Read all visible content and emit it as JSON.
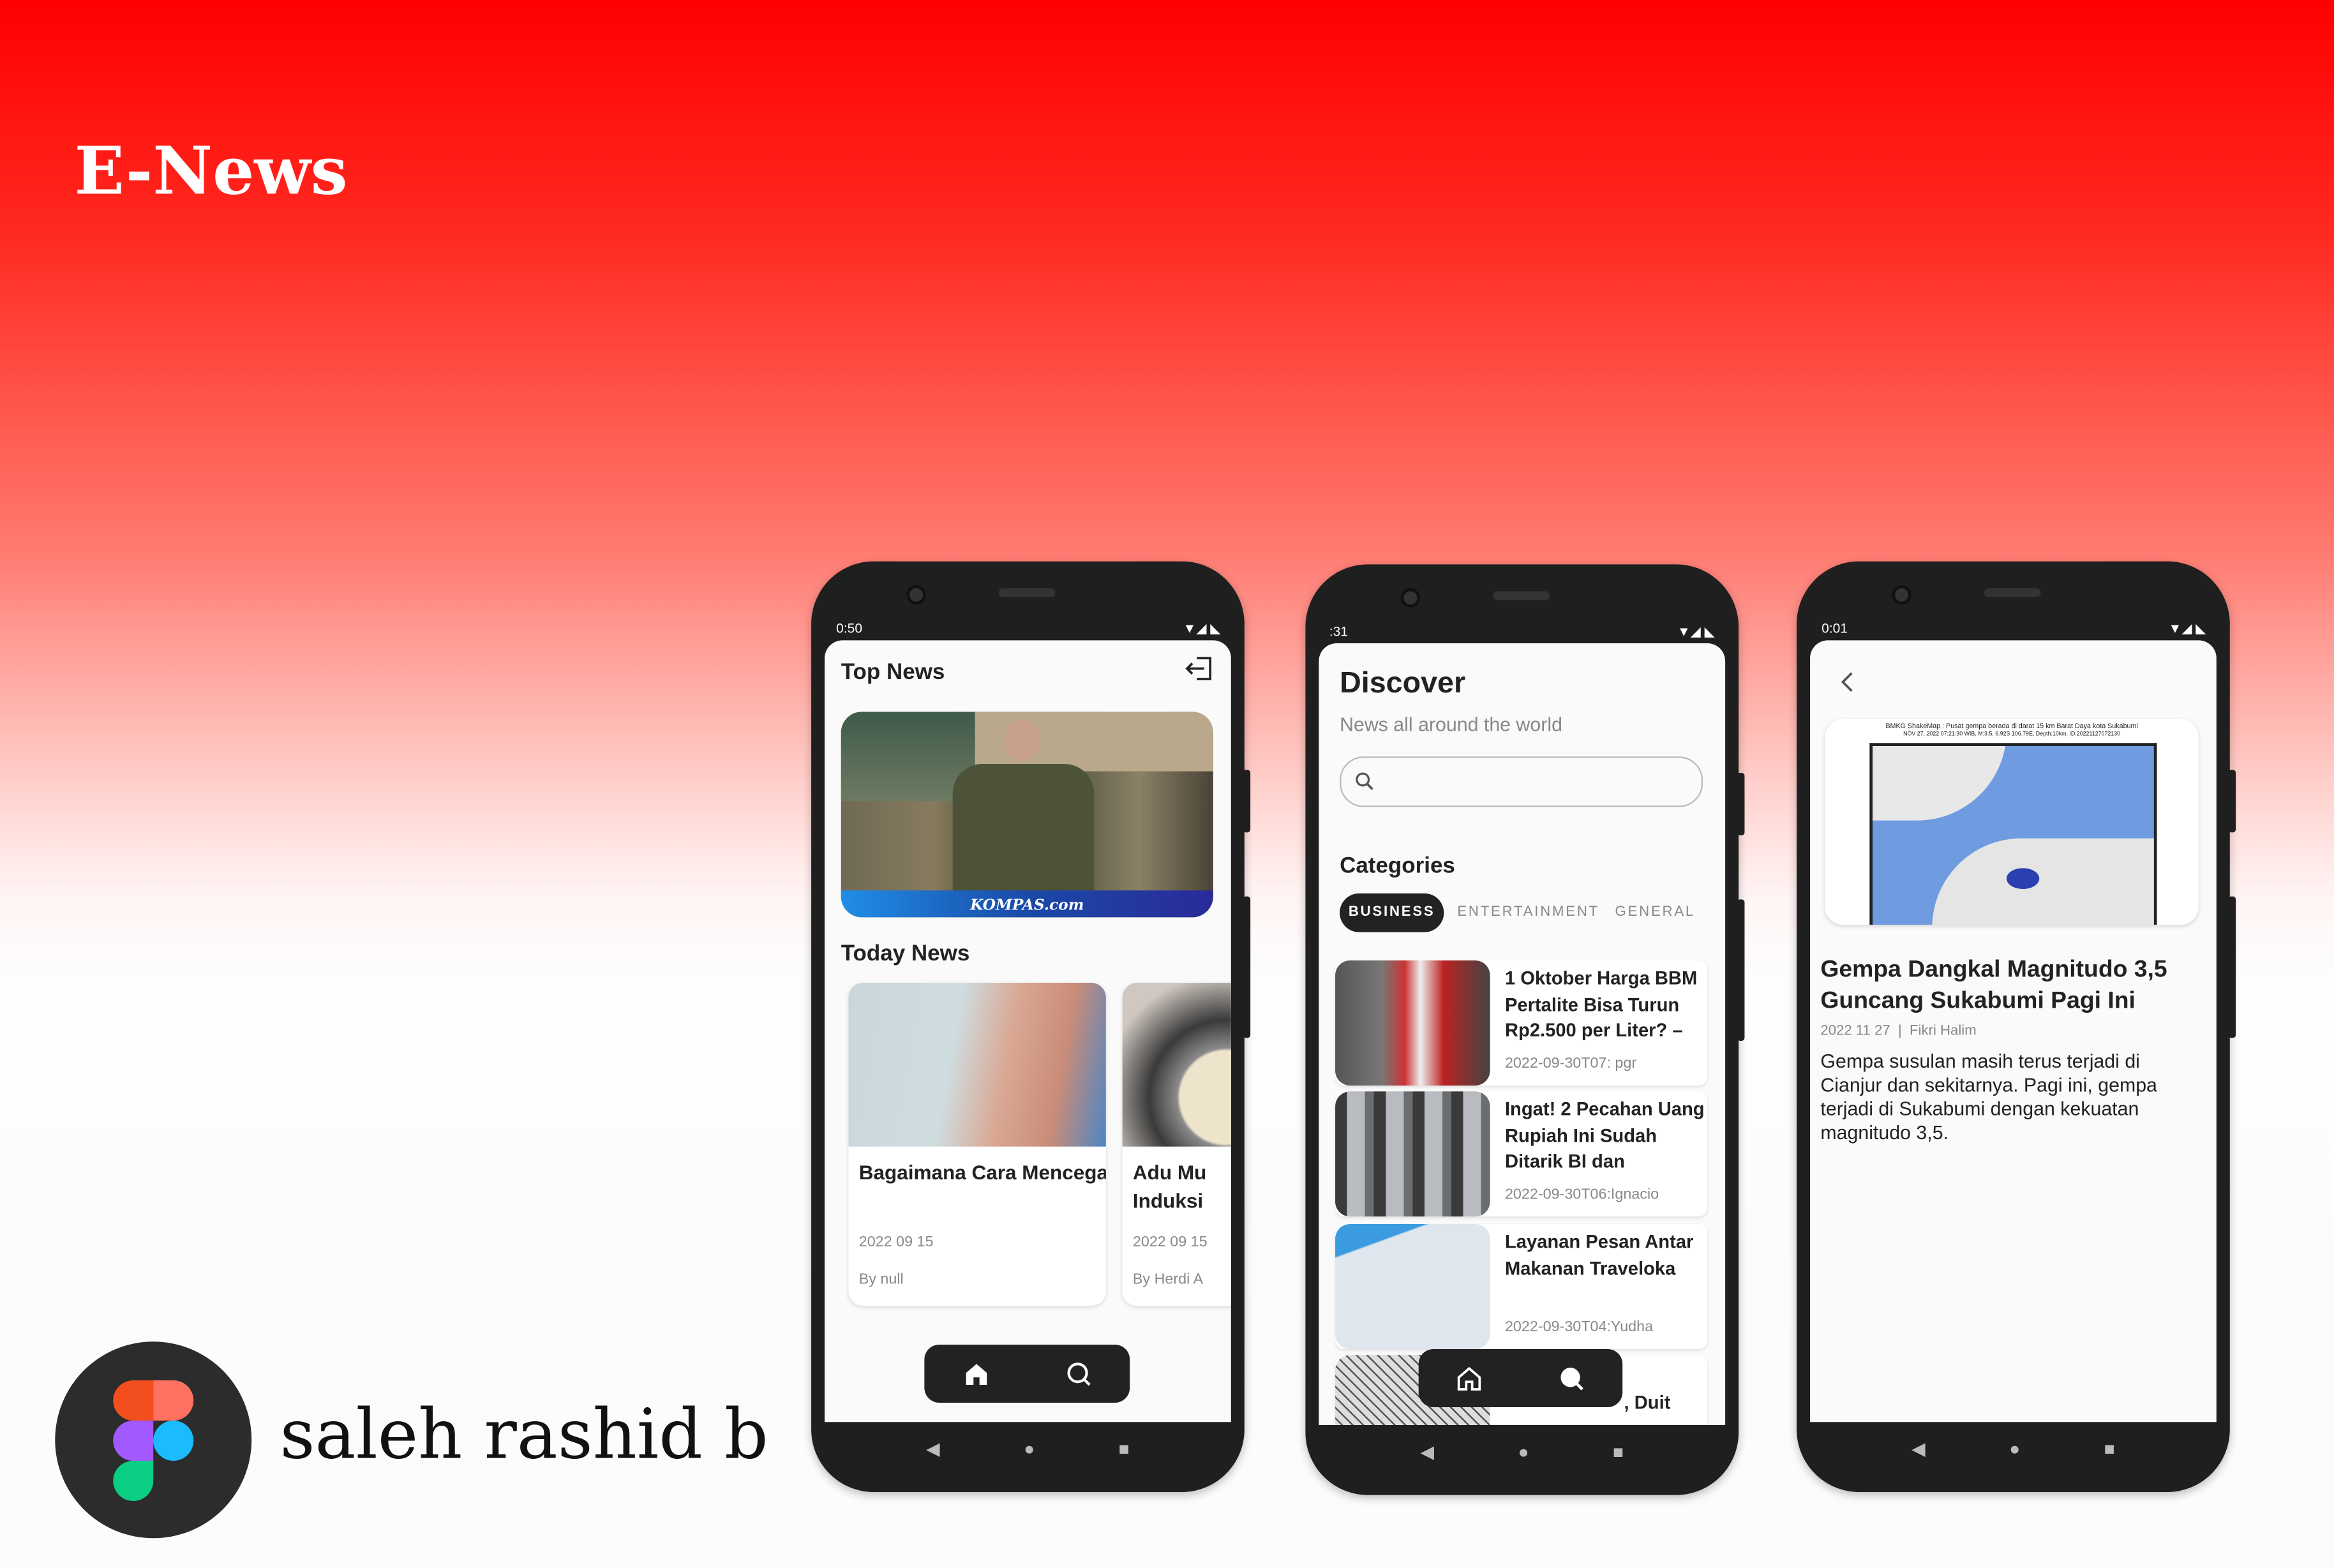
{
  "brand": {
    "title": "E-News",
    "author": "saleh rashid b",
    "logo": "figma-logo"
  },
  "colors": {
    "accent": "#ff0000",
    "dark": "#222222"
  },
  "phone1": {
    "status_time": " 0:50",
    "title": "Top News",
    "logout_icon": "logout-icon",
    "hero": {
      "watermark": "KOMPAS.com"
    },
    "section": "Today News",
    "cards": [
      {
        "title": "Bagaimana Cara Mencegah Penyakit G...",
        "date": "2022 09 15",
        "author": "By null"
      },
      {
        "title": "Adu Mu Induksi",
        "date": "2022 09 15",
        "author": "By Herdi A"
      }
    ],
    "nav": [
      "home-icon",
      "search-icon"
    ]
  },
  "phone2": {
    "status_time": ":31",
    "title": "Discover",
    "subtitle": "News all around the world",
    "search": {
      "value": "",
      "placeholder": ""
    },
    "categories_label": "Categories",
    "categories": [
      {
        "label": "BUSINESS",
        "active": true
      },
      {
        "label": "ENTERTAINMENT",
        "active": false
      },
      {
        "label": "GENERAL",
        "active": false
      }
    ],
    "articles": [
      {
        "title": "1 Oktober Harga BBM Pertalite Bisa Turun Rp2.500 per Liter? –",
        "meta": "2022-09-30T07: pgr"
      },
      {
        "title": "Ingat! 2 Pecahan Uang Rupiah Ini Sudah Ditarik BI dan",
        "meta": "2022-09-30T06:Ignacio"
      },
      {
        "title": "Layanan Pesan Antar Makanan Traveloka",
        "meta": "2022-09-30T04:Yudha"
      },
      {
        "title": ", Duit",
        "meta": ""
      }
    ]
  },
  "phone3": {
    "status_time": " 0:01",
    "image_caption": "BMKG ShakeMap : Pusat gempa berada di darat 15 km Barat Daya kota Sukabumi",
    "image_subcaption": "NOV 27, 2022 07:21:30 WIB, M:3.5, 6.92S 106.79E, Depth:10km, ID:20221127072130",
    "title": "Gempa Dangkal Magnitudo 3,5 Guncang Sukabumi Pagi Ini",
    "date": "2022 11 27",
    "separator": "|",
    "author": "Fikri Halim",
    "body": "Gempa susulan masih terus terjadi di Cianjur dan sekitarnya. Pagi ini, gempa terjadi di Sukabumi dengan kekuatan magnitudo 3,5."
  },
  "system_nav": {
    "back": "◀",
    "home": "●",
    "recents": "■"
  }
}
